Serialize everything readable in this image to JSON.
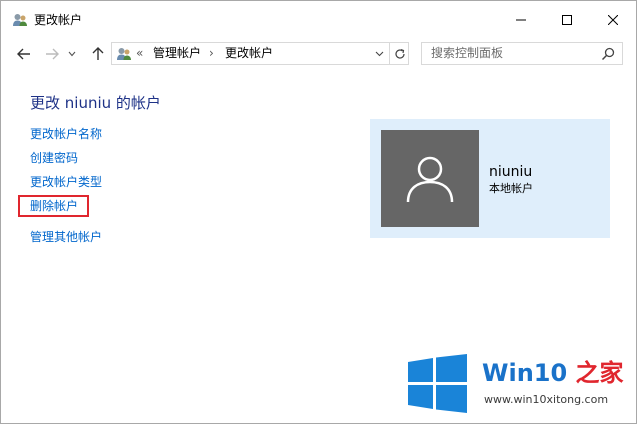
{
  "window": {
    "title": "更改帐户"
  },
  "nav": {
    "breadcrumb_prefix": "«",
    "breadcrumb_1": "管理帐户",
    "breadcrumb_sep": "›",
    "breadcrumb_2": "更改帐户"
  },
  "search": {
    "placeholder": "搜索控制面板"
  },
  "main": {
    "title": "更改 niuniu 的帐户",
    "tasks": [
      {
        "label": "更改帐户名称"
      },
      {
        "label": "创建密码"
      },
      {
        "label": "更改帐户类型"
      },
      {
        "label": "删除帐户"
      },
      {
        "label": "管理其他帐户"
      }
    ]
  },
  "account": {
    "name": "niuniu",
    "type": "本地帐户"
  },
  "watermark": {
    "brand_a": "Win10",
    "brand_b": "之家",
    "url": "www.win10xitong.com"
  },
  "colors": {
    "link": "#0066cc",
    "title": "#1e3287",
    "panel_bg": "#dfeefb",
    "avatar_bg": "#666666",
    "highlight": "#e0262e",
    "brand": "#1a72c9"
  }
}
